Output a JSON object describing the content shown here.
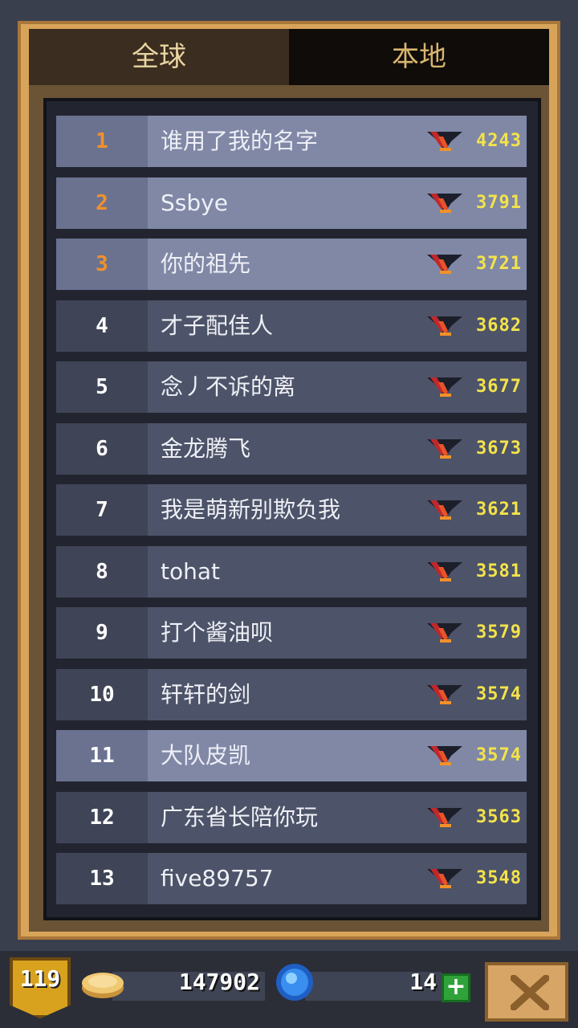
{
  "tabs": {
    "global": "全球",
    "local": "本地"
  },
  "leaderboard": [
    {
      "rank": "1",
      "name": "谁用了我的名字",
      "score": "4243",
      "highlight": true,
      "rank_color": "orange"
    },
    {
      "rank": "2",
      "name": "Ssbye",
      "score": "3791",
      "highlight": true,
      "rank_color": "orange"
    },
    {
      "rank": "3",
      "name": "你的祖先",
      "score": "3721",
      "highlight": true,
      "rank_color": "orange"
    },
    {
      "rank": "4",
      "name": "才子配佳人",
      "score": "3682",
      "highlight": false,
      "rank_color": "white"
    },
    {
      "rank": "5",
      "name": "念丿不诉的离",
      "score": "3677",
      "highlight": false,
      "rank_color": "white"
    },
    {
      "rank": "6",
      "name": "金龙腾飞",
      "score": "3673",
      "highlight": false,
      "rank_color": "white"
    },
    {
      "rank": "7",
      "name": "我是萌新别欺负我",
      "score": "3621",
      "highlight": false,
      "rank_color": "white"
    },
    {
      "rank": "8",
      "name": "tohat",
      "score": "3581",
      "highlight": false,
      "rank_color": "white"
    },
    {
      "rank": "9",
      "name": "打个酱油呗",
      "score": "3579",
      "highlight": false,
      "rank_color": "white"
    },
    {
      "rank": "10",
      "name": "轩轩的剑",
      "score": "3574",
      "highlight": false,
      "rank_color": "white"
    },
    {
      "rank": "11",
      "name": "大队皮凯",
      "score": "3574",
      "highlight": true,
      "rank_color": "white"
    },
    {
      "rank": "12",
      "name": "广东省长陪你玩",
      "score": "3563",
      "highlight": false,
      "rank_color": "white"
    },
    {
      "rank": "13",
      "name": "five89757",
      "score": "3548",
      "highlight": false,
      "rank_color": "white"
    }
  ],
  "footer": {
    "level": "119",
    "coins": "147902",
    "gems": "14",
    "plus_label": "+"
  },
  "colors": {
    "accent_gold": "#d8a45a",
    "score_yellow": "#f3e34a",
    "rank_orange": "#f2912a"
  }
}
